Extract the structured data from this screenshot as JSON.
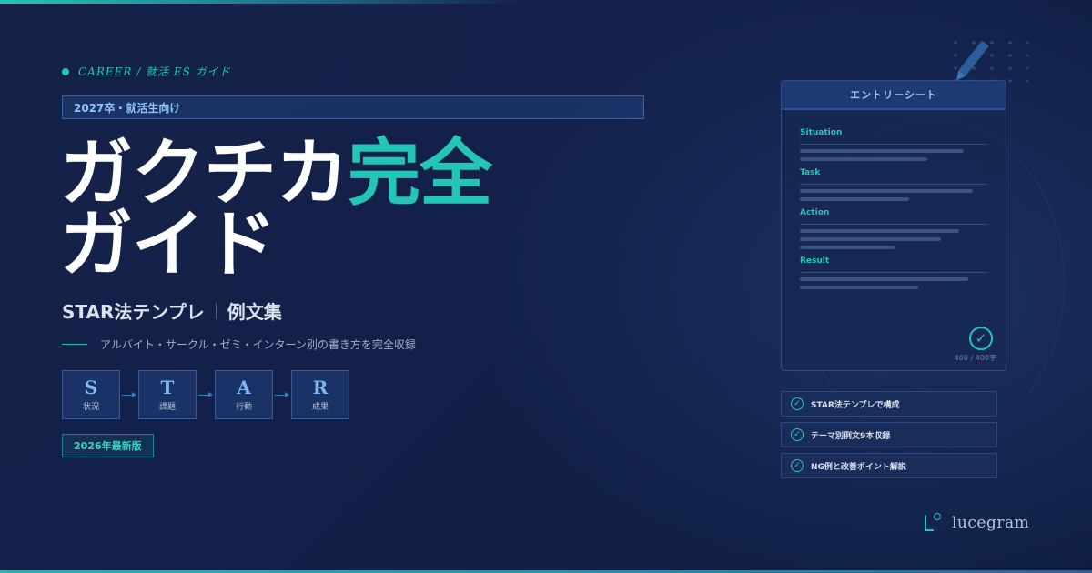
{
  "eyebrow": "CAREER / 就活 ES ガイド",
  "target_badge": "2027卒・就活生向け",
  "title": {
    "line1_white": "ガクチカ",
    "line1_accent": "完全",
    "line2": "ガイド"
  },
  "subtitle": {
    "left": "STAR法テンプレ",
    "right": "例文集"
  },
  "description": "アルバイト・サークル・ゼミ・インターン別の書き方を完全収録",
  "star_steps": [
    {
      "letter": "S",
      "label": "状況"
    },
    {
      "letter": "T",
      "label": "課題"
    },
    {
      "letter": "A",
      "label": "行動"
    },
    {
      "letter": "R",
      "label": "成果"
    }
  ],
  "edition_badge": "2026年最新版",
  "sheet": {
    "title": "エントリーシート",
    "sections": [
      "Situation",
      "Task",
      "Action",
      "Result"
    ],
    "count": "400 / 400字"
  },
  "features": [
    "STAR法テンプレで構成",
    "テーマ別例文9本収録",
    "NG例と改善ポイント解説"
  ],
  "brand": "lucegram",
  "colors": {
    "accent": "#22c5b8",
    "background": "#14224a",
    "star_letter": "#7db8ee"
  }
}
